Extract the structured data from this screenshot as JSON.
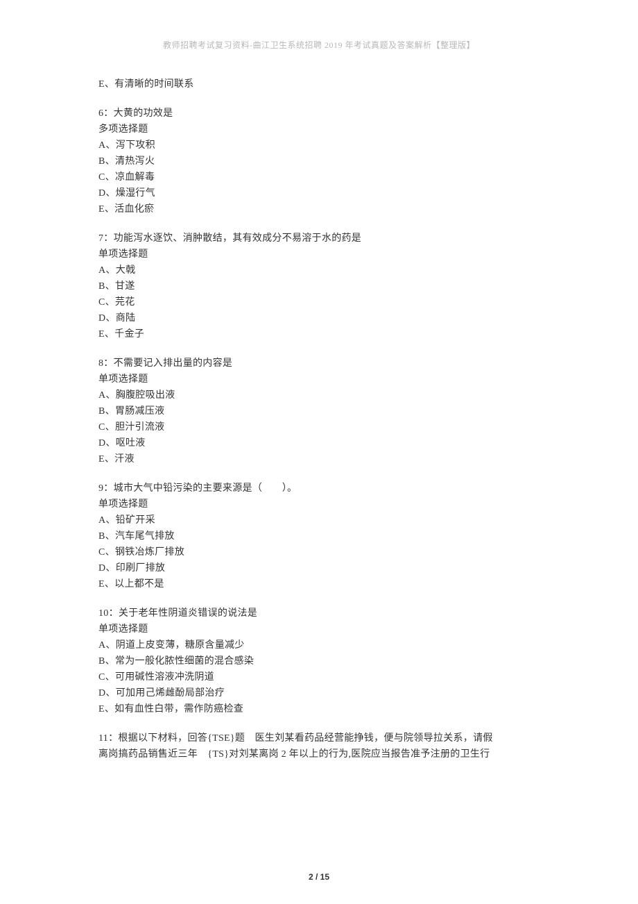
{
  "header": "教师招聘考试复习资料-曲江卫生系统招聘 2019 年考试真题及答案解析【整理版】",
  "topOption": "E、有清晰的时间联系",
  "questions": [
    {
      "title": "6：大黄的功效是",
      "type": "多项选择题",
      "options": [
        "A、泻下攻积",
        "B、清热泻火",
        "C、凉血解毒",
        "D、燥湿行气",
        "E、活血化瘀"
      ]
    },
    {
      "title": "7：功能泻水逐饮、消肿散结，其有效成分不易溶于水的药是",
      "type": "单项选择题",
      "options": [
        "A、大戟",
        "B、甘遂",
        "C、芫花",
        "D、商陆",
        "E、千金子"
      ]
    },
    {
      "title": "8：不需要记入排出量的内容是",
      "type": "单项选择题",
      "options": [
        "A、胸腹腔吸出液",
        "B、胃肠减压液",
        "C、胆汁引流液",
        "D、呕吐液",
        "E、汗液"
      ]
    },
    {
      "title": "9：城市大气中铅污染的主要来源是（　　）。",
      "type": "单项选择题",
      "options": [
        "A、铅矿开采",
        "B、汽车尾气排放",
        "C、钢铁冶炼厂排放",
        "D、印刷厂排放",
        "E、以上都不是"
      ]
    },
    {
      "title": "10：关于老年性阴道炎错误的说法是",
      "type": "单项选择题",
      "options": [
        "A、阴道上皮变薄，糖原含量减少",
        "B、常为一般化脓性细菌的混合感染",
        "C、可用碱性溶液冲洗阴道",
        "D、可加用己烯雌酚局部治疗",
        "E、如有血性白带，需作防癌检查"
      ]
    }
  ],
  "trailing": [
    "11：根据以下材料，回答{TSE}题　医生刘某看药品经营能挣钱，便与院领导拉关系，请假",
    "离岗搞药品销售近三年　{TS}对刘某离岗 2 年以上的行为,医院应当报告准予注册的卫生行"
  ],
  "footer": "2 / 15"
}
